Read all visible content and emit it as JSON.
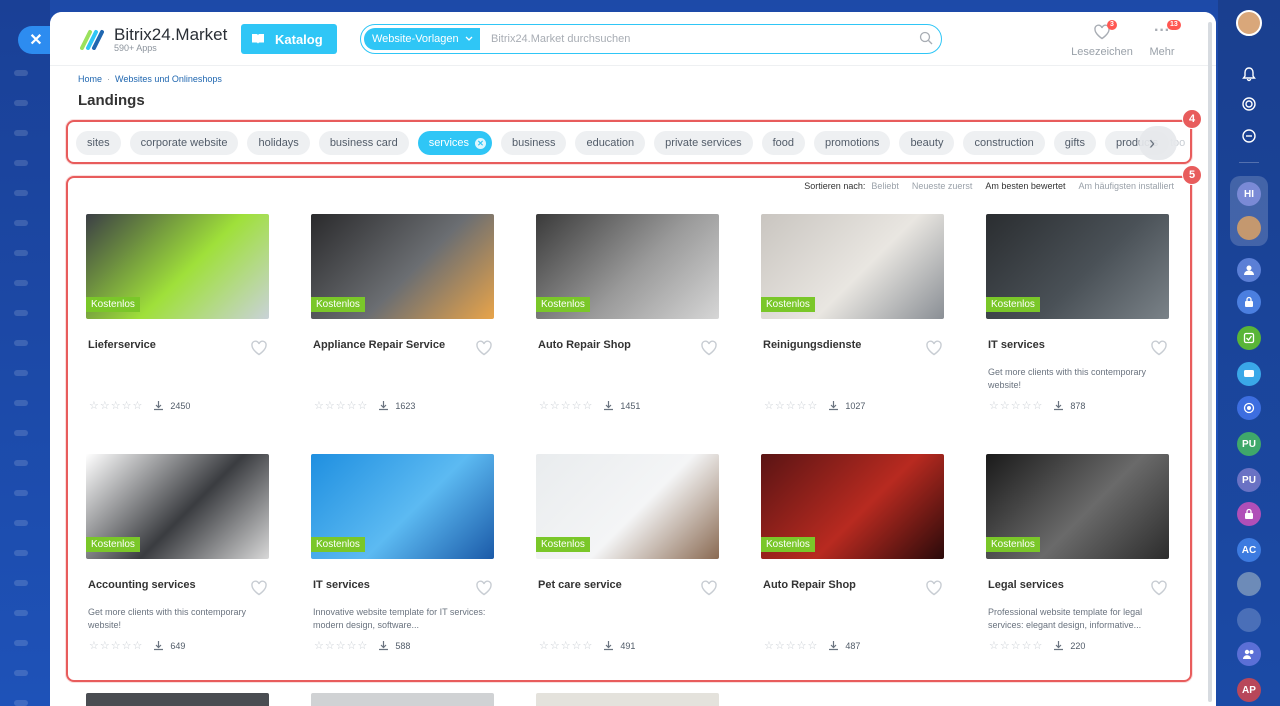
{
  "header": {
    "brand": "Bitrix24.Market",
    "apps_count": "590+ Apps",
    "katalog_label": "Katalog",
    "search_scope": "Website-Vorlagen",
    "search_placeholder": "Bitrix24.Market durchsuchen",
    "bookmarks_label": "Lesezeichen",
    "bookmarks_badge": "3",
    "more_label": "Mehr",
    "more_badge": "13"
  },
  "breadcrumb": {
    "home": "Home",
    "section": "Websites und Onlineshops"
  },
  "page_title": "Landings",
  "annotations": {
    "tags_box": "4",
    "cards_box": "5"
  },
  "tags": [
    {
      "label": "sites",
      "active": false
    },
    {
      "label": "corporate website",
      "active": false
    },
    {
      "label": "holidays",
      "active": false
    },
    {
      "label": "business card",
      "active": false
    },
    {
      "label": "services",
      "active": true
    },
    {
      "label": "business",
      "active": false
    },
    {
      "label": "education",
      "active": false
    },
    {
      "label": "private services",
      "active": false
    },
    {
      "label": "food",
      "active": false
    },
    {
      "label": "promotions",
      "active": false
    },
    {
      "label": "beauty",
      "active": false
    },
    {
      "label": "construction",
      "active": false
    },
    {
      "label": "gifts",
      "active": false
    },
    {
      "label": "products",
      "active": false
    }
  ],
  "tags_overflow_text": "too",
  "sort": {
    "label": "Sortieren nach:",
    "options": [
      "Beliebt",
      "Neueste zuerst",
      "Am besten bewertet",
      "Am häufigsten installiert"
    ],
    "current": "Am besten bewertet"
  },
  "free_badge": "Kostenlos",
  "cards": [
    {
      "name": "Lieferservice",
      "desc": "",
      "installs": "2450",
      "colors": [
        "#3b3f45",
        "#9fe03a",
        "#c9d2d8"
      ]
    },
    {
      "name": "Appliance Repair Service",
      "desc": "",
      "installs": "1623",
      "colors": [
        "#2a2a2c",
        "#6b6e72",
        "#e8a44a"
      ]
    },
    {
      "name": "Auto Repair Shop",
      "desc": "",
      "installs": "1451",
      "colors": [
        "#3a3a3a",
        "#9a9a9a",
        "#d6d6d6"
      ]
    },
    {
      "name": "Reinigungsdienste",
      "desc": "",
      "installs": "1027",
      "colors": [
        "#c9c5c0",
        "#e9e6e1",
        "#8a8f95"
      ]
    },
    {
      "name": "IT services",
      "desc": "Get more clients with this contemporary website!",
      "installs": "878",
      "colors": [
        "#2a2d30",
        "#4a5157",
        "#7a8288"
      ]
    },
    {
      "name": "Accounting services",
      "desc": "Get more clients with this contemporary website!",
      "installs": "649",
      "colors": [
        "#ffffff",
        "#3a3c40",
        "#d8d8d8"
      ]
    },
    {
      "name": "IT services",
      "desc": "Innovative website template for IT services: modern design, software...",
      "installs": "588",
      "colors": [
        "#1f8fe0",
        "#5cbaf2",
        "#1b5aa8"
      ]
    },
    {
      "name": "Pet care service",
      "desc": "",
      "installs": "491",
      "colors": [
        "#e9ecee",
        "#f4f5f6",
        "#8a6a52"
      ]
    },
    {
      "name": "Auto Repair Shop",
      "desc": "",
      "installs": "487",
      "colors": [
        "#5a1414",
        "#b82a20",
        "#2a0a0a"
      ]
    },
    {
      "name": "Legal services",
      "desc": "Professional website template for legal services: elegant design, informative...",
      "installs": "220",
      "colors": [
        "#1a1a1a",
        "#6a6a6a",
        "#2c2c2c"
      ]
    }
  ],
  "peek_colors": [
    "#4a4d52",
    "#d0d2d4",
    "#e4e2dc"
  ],
  "sidebar_right": [
    "HI",
    "PU",
    "PU",
    "AC",
    "AP"
  ],
  "colors": {
    "accent": "#2fc6f6",
    "free_badge": "#7ac729",
    "annotation": "#e85c5c",
    "badge": "#ff5752"
  }
}
